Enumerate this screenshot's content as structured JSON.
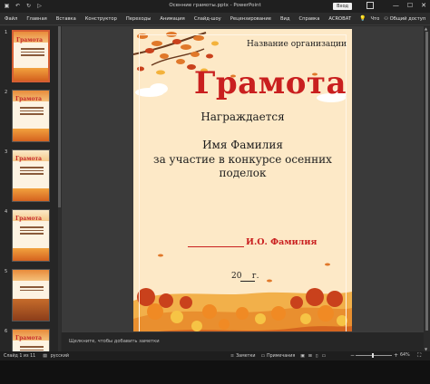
{
  "window": {
    "title": "Осенние грамоты.pptx  -  PowerPoint",
    "signin_label": "Вход",
    "minimize": "—",
    "maximize": "☐",
    "close": "✕"
  },
  "qat": {
    "save_icon": "save-icon",
    "undo_icon": "undo-icon",
    "redo_icon": "redo-icon",
    "present_icon": "present-icon"
  },
  "menu": {
    "tabs": [
      "Файл",
      "Главная",
      "Вставка",
      "Конструктор",
      "Переходы",
      "Анимация",
      "Слайд-шоу",
      "Рецензирование",
      "Вид",
      "Справка",
      "ACROBAT"
    ],
    "search_icon": "lightbulb-icon",
    "search_label": "Что",
    "share_label": "Общий доступ"
  },
  "thumbnails": {
    "items": [
      {
        "num": "1",
        "title": "Грамота",
        "selected": true
      },
      {
        "num": "2",
        "title": "Грамота",
        "selected": false
      },
      {
        "num": "3",
        "title": "Грамота",
        "selected": false
      },
      {
        "num": "4",
        "title": "Грамота",
        "selected": false
      },
      {
        "num": "5",
        "title": "",
        "selected": false
      },
      {
        "num": "6",
        "title": "Грамота",
        "selected": false
      }
    ]
  },
  "slide": {
    "organization": "Название организации",
    "heading": "Грамота",
    "awarded": "Награждается",
    "recipient": "Имя Фамилия",
    "reason_line1": "за участие в конкурсе осенних",
    "reason_line2": "поделок",
    "signer": "И.О. Фамилия",
    "year": "20",
    "year_suffix": "г.",
    "signature_blank": "____________"
  },
  "notes": {
    "placeholder": "Щелкните, чтобы добавить заметки"
  },
  "status": {
    "slide_info": "Слайд 1 из 11",
    "language": "русский",
    "notes_label": "Заметки",
    "comments_label": "Примечания",
    "zoom": "64"
  },
  "colors": {
    "accent": "#d65f34",
    "heading_red": "#c91f1f",
    "slide_bg": "#fde9c7"
  }
}
